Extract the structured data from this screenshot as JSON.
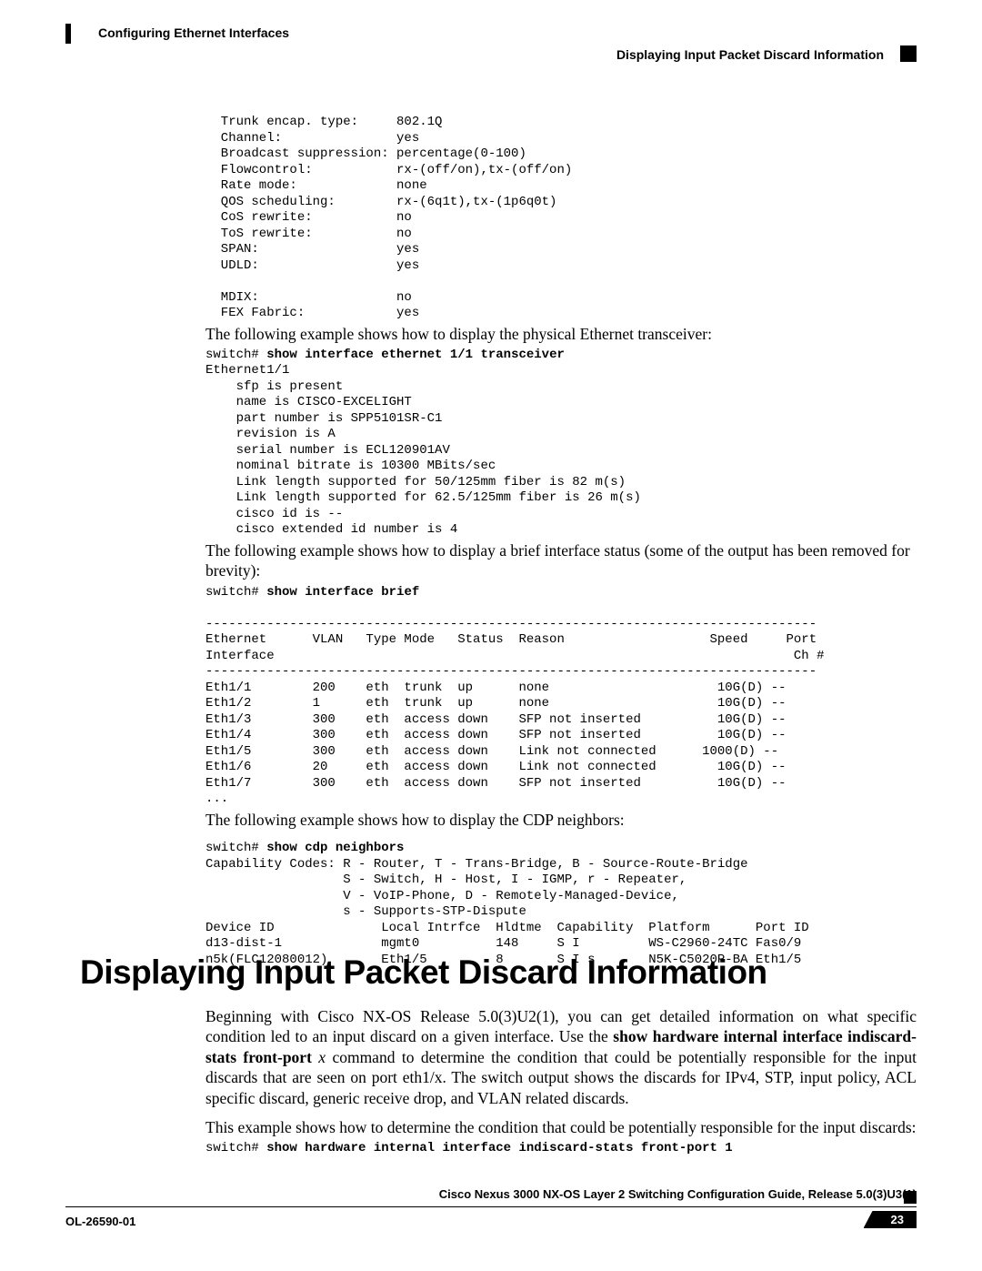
{
  "header": {
    "chapter": "Configuring Ethernet Interfaces",
    "section": "Displaying Input Packet Discard Information"
  },
  "capabilities_block": "  Trunk encap. type:     802.1Q\n  Channel:               yes\n  Broadcast suppression: percentage(0-100)\n  Flowcontrol:           rx-(off/on),tx-(off/on)\n  Rate mode:             none\n  QOS scheduling:        rx-(6q1t),tx-(1p6q0t)\n  CoS rewrite:           no\n  ToS rewrite:           no\n  SPAN:                  yes\n  UDLD:                  yes\n\n  MDIX:                  no\n  FEX Fabric:            yes",
  "transceiver_intro": "The following example shows how to display the physical Ethernet transceiver:",
  "transceiver_prompt": "switch# ",
  "transceiver_cmd": "show interface ethernet 1/1 transceiver",
  "transceiver_output": "Ethernet1/1\n    sfp is present\n    name is CISCO-EXCELIGHT\n    part number is SPP5101SR-C1\n    revision is A\n    serial number is ECL120901AV\n    nominal bitrate is 10300 MBits/sec\n    Link length supported for 50/125mm fiber is 82 m(s)\n    Link length supported for 62.5/125mm fiber is 26 m(s)\n    cisco id is --\n    cisco extended id number is 4",
  "brief_intro": "The following example shows how to display a brief interface status (some of the output has been removed for brevity):",
  "brief_prompt": "switch# ",
  "brief_cmd": "show interface brief",
  "brief_output": "\n--------------------------------------------------------------------------------\nEthernet      VLAN   Type Mode   Status  Reason                   Speed     Port\nInterface                                                                    Ch #\n--------------------------------------------------------------------------------\nEth1/1        200    eth  trunk  up      none                      10G(D) --\nEth1/2        1      eth  trunk  up      none                      10G(D) --\nEth1/3        300    eth  access down    SFP not inserted          10G(D) --\nEth1/4        300    eth  access down    SFP not inserted          10G(D) --\nEth1/5        300    eth  access down    Link not connected      1000(D) --\nEth1/6        20     eth  access down    Link not connected        10G(D) --\nEth1/7        300    eth  access down    SFP not inserted          10G(D) --\n...",
  "cdp_intro": "The following example shows how to display the CDP neighbors:",
  "cdp_prompt": "switch# ",
  "cdp_cmd": "show cdp neighbors",
  "cdp_output": "Capability Codes: R - Router, T - Trans-Bridge, B - Source-Route-Bridge\n                  S - Switch, H - Host, I - IGMP, r - Repeater,\n                  V - VoIP-Phone, D - Remotely-Managed-Device,\n                  s - Supports-STP-Dispute\nDevice ID              Local Intrfce  Hldtme  Capability  Platform      Port ID\nd13-dist-1             mgmt0          148     S I         WS-C2960-24TC Fas0/9\nn5k(FLC12080012)       Eth1/5         8       S I s       N5K-C5020P-BA Eth1/5",
  "h1": "Displaying Input Packet Discard Information",
  "body1_prefix": "Beginning with Cisco NX-OS Release 5.0(3)U2(1), you can get detailed information on what specific condition led to an input discard on a given interface. Use the ",
  "body1_bold1": "show hardware internal interface indiscard-stats front-port",
  "body1_mid": " x command to determine the condition that could be potentially responsible for the input discards that are seen on port eth1/x. The switch output shows the discards for IPv4, STP, input policy, ACL specific discard, generic receive drop, and VLAN related discards.",
  "body2": "This example shows how to determine the condition that could be potentially responsible for the input discards:",
  "ex_prompt": "switch# ",
  "ex_cmd": "show hardware internal interface indiscard-stats front-port 1",
  "footer": {
    "guide": "Cisco Nexus 3000 NX-OS Layer 2 Switching Configuration Guide, Release 5.0(3)U3(1)",
    "doc": "OL-26590-01",
    "page": "23"
  }
}
